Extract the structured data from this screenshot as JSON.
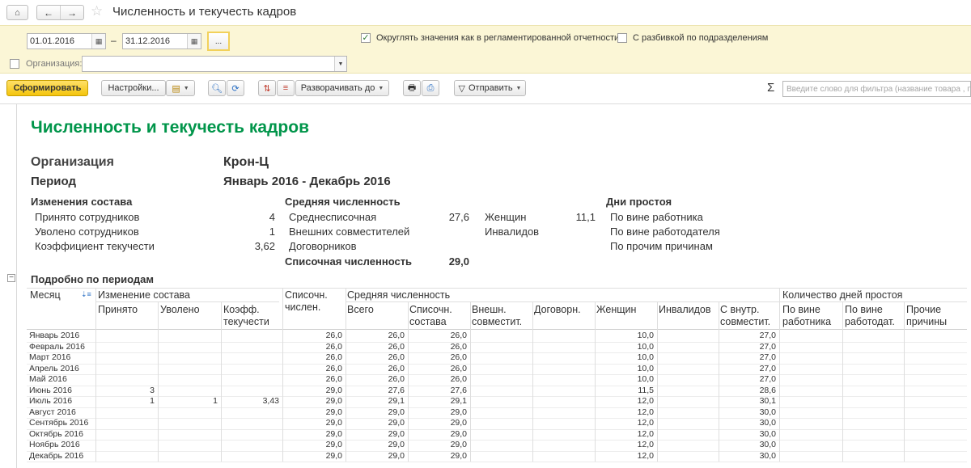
{
  "window": {
    "title": "Численность и текучесть кадров",
    "home_icon": "home-icon",
    "back_icon": "arrow-left-icon",
    "forward_icon": "arrow-right-icon",
    "favorite_icon": "star-icon"
  },
  "settings": {
    "date_from": "01.01.2016",
    "date_to": "31.12.2016",
    "date_separator": "–",
    "period_button": "...",
    "round_values_label": "Округлять значения как в регламентированной отчетности",
    "round_values_checked": true,
    "by_department_label": "С разбивкой по подразделениям",
    "by_department_checked": false,
    "organization_label": "Организация:",
    "organization_checked": false,
    "organization_value": ""
  },
  "toolbar": {
    "generate_label": "Сформировать",
    "settings_label": "Настройки...",
    "expand_label": "Разворачивать до",
    "send_label": "Отправить",
    "sigma": "Σ",
    "filter_placeholder": "Введите слово для фильтра (название товара , покупателя и т.д.)"
  },
  "report": {
    "title": "Численность и текучесть кадров",
    "org_label": "Организация",
    "org_value": "Крон-Ц",
    "period_label": "Период",
    "period_value": "Январь 2016 - Декабрь 2016",
    "changes": {
      "heading": "Изменения состава",
      "hired_label": "Принято сотрудников",
      "hired_value": "4",
      "fired_label": "Уволено сотрудников",
      "fired_value": "1",
      "turnover_label": "Коэффициент текучести",
      "turnover_value": "3,62"
    },
    "avg": {
      "heading": "Средняя численность",
      "avg_list_label": "Среднесписочная",
      "avg_list_value": "27,6",
      "external_label": "Внешних совместителей",
      "contractors_label": "Договорников",
      "list_total_label": "Списочная численность",
      "list_total_value": "29,0",
      "women_label": "Женщин",
      "women_value": "11,1",
      "disabled_label": "Инвалидов"
    },
    "idle": {
      "heading": "Дни простоя",
      "employee_fault": "По вине работника",
      "employer_fault": "По вине работодателя",
      "other_reasons": "По прочим причинам"
    },
    "detail_heading": "Подробно по периодам",
    "table": {
      "col_month": "Месяц",
      "group_changes": "Изменение состава",
      "col_hired": "Принято",
      "col_fired": "Уволено",
      "col_coef_1": "Коэфф.",
      "col_coef_2": "текучести",
      "col_list_1": "Списочн.",
      "col_list_2": "числен.",
      "group_avg": "Средняя численность",
      "col_total": "Всего",
      "col_avg_list_1": "Списочн.",
      "col_avg_list_2": "состава",
      "col_ext_1": "Внешн.",
      "col_ext_2": "совместит.",
      "col_contract": "Договорн.",
      "col_women": "Женщин",
      "col_disabled": "Инвалидов",
      "col_internal_1": "С внутр.",
      "col_internal_2": "совместит.",
      "group_idle": "Количество дней простоя",
      "col_emp_1": "По вине",
      "col_emp_2": "работника",
      "col_er_1": "По вине",
      "col_er_2": "работодат.",
      "col_other_1": "Прочие",
      "col_other_2": "причины",
      "rows": [
        {
          "month": "Январь 2016",
          "hired": "",
          "fired": "",
          "coef": "",
          "list": "26,0",
          "total": "26,0",
          "avg_list": "26,0",
          "women": "10,0",
          "internal": "27,0"
        },
        {
          "month": "Февраль 2016",
          "hired": "",
          "fired": "",
          "coef": "",
          "list": "26,0",
          "total": "26,0",
          "avg_list": "26,0",
          "women": "10,0",
          "internal": "27,0"
        },
        {
          "month": "Март 2016",
          "hired": "",
          "fired": "",
          "coef": "",
          "list": "26,0",
          "total": "26,0",
          "avg_list": "26,0",
          "women": "10,0",
          "internal": "27,0"
        },
        {
          "month": "Апрель 2016",
          "hired": "",
          "fired": "",
          "coef": "",
          "list": "26,0",
          "total": "26,0",
          "avg_list": "26,0",
          "women": "10,0",
          "internal": "27,0"
        },
        {
          "month": "Май 2016",
          "hired": "",
          "fired": "",
          "coef": "",
          "list": "26,0",
          "total": "26,0",
          "avg_list": "26,0",
          "women": "10,0",
          "internal": "27,0"
        },
        {
          "month": "Июнь 2016",
          "hired": "3",
          "fired": "",
          "coef": "",
          "list": "29,0",
          "total": "27,6",
          "avg_list": "27,6",
          "women": "11,5",
          "internal": "28,6"
        },
        {
          "month": "Июль 2016",
          "hired": "1",
          "fired": "1",
          "coef": "3,43",
          "list": "29,0",
          "total": "29,1",
          "avg_list": "29,1",
          "women": "12,0",
          "internal": "30,1"
        },
        {
          "month": "Август 2016",
          "hired": "",
          "fired": "",
          "coef": "",
          "list": "29,0",
          "total": "29,0",
          "avg_list": "29,0",
          "women": "12,0",
          "internal": "30,0"
        },
        {
          "month": "Сентябрь 2016",
          "hired": "",
          "fired": "",
          "coef": "",
          "list": "29,0",
          "total": "29,0",
          "avg_list": "29,0",
          "women": "12,0",
          "internal": "30,0"
        },
        {
          "month": "Октябрь 2016",
          "hired": "",
          "fired": "",
          "coef": "",
          "list": "29,0",
          "total": "29,0",
          "avg_list": "29,0",
          "women": "12,0",
          "internal": "30,0"
        },
        {
          "month": "Ноябрь 2016",
          "hired": "",
          "fired": "",
          "coef": "",
          "list": "29,0",
          "total": "29,0",
          "avg_list": "29,0",
          "women": "12,0",
          "internal": "30,0"
        },
        {
          "month": "Декабрь 2016",
          "hired": "",
          "fired": "",
          "coef": "",
          "list": "29,0",
          "total": "29,0",
          "avg_list": "29,0",
          "women": "12,0",
          "internal": "30,0"
        }
      ]
    }
  }
}
